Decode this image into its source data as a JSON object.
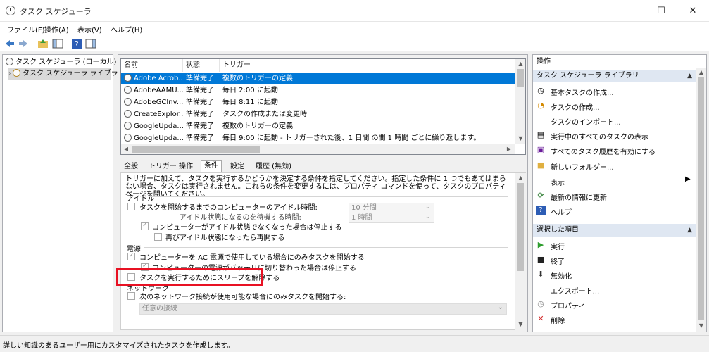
{
  "window": {
    "title": "タスク スケジューラ",
    "controls": {
      "minimize": "—",
      "maximize": "☐",
      "close": "✕"
    }
  },
  "menu": [
    "ファイル(F)",
    "操作(A)",
    "表示(V)",
    "ヘルプ(H)"
  ],
  "tree": {
    "root": "タスク スケジューラ (ローカル)",
    "child": "タスク スケジューラ ライブラリ"
  },
  "task_table": {
    "columns": [
      "名前",
      "状態",
      "トリガー"
    ],
    "rows": [
      {
        "name": "Adobe Acrob...",
        "status": "準備完了",
        "trigger": "複数のトリガーの定義"
      },
      {
        "name": "AdobeAAMU...",
        "status": "準備完了",
        "trigger": "毎日 2:00 に起動"
      },
      {
        "name": "AdobeGCInv...",
        "status": "準備完了",
        "trigger": "毎日 8:11 に起動"
      },
      {
        "name": "CreateExplor...",
        "status": "準備完了",
        "trigger": "タスクの作成または変更時"
      },
      {
        "name": "GoogleUpda...",
        "status": "準備完了",
        "trigger": "複数のトリガーの定義"
      },
      {
        "name": "GoogleUpda...",
        "status": "準備完了",
        "trigger": "毎日 9:00 に起動 - トリガーされた後、1 日間 の間 1 時間 ごとに繰り返します。"
      }
    ]
  },
  "tabs": [
    "全般",
    "トリガー",
    "操作",
    "条件",
    "設定",
    "履歴 (無効)"
  ],
  "conditions": {
    "intro": "トリガーに加えて、タスクを実行するかどうかを決定する条件を指定してください。指定した条件に 1 つでもあてはまらない場合、タスクは実行されません。これらの条件を変更するには、プロパティ コマンドを使って、タスクのプロパティ ページを開いてください。",
    "idle_group": "アイドル",
    "idle_start": "タスクを開始するまでのコンピューターのアイドル時間:",
    "idle_start_value": "10 分間",
    "idle_wait": "アイドル状態になるのを待機する時間:",
    "idle_wait_value": "1 時間",
    "idle_stop": "コンピューターがアイドル状態でなくなった場合は停止する",
    "idle_restart": "再びアイドル状態になったら再開する",
    "power_group": "電源",
    "power_ac_only": "コンピューターを AC 電源で使用している場合にのみタスクを開始する",
    "power_battery_stop": "コンピューターの電源がバッテリに切り替わった場合は停止する",
    "wake_to_run": "タスクを実行するためにスリープを解除する",
    "network_group": "ネットワーク",
    "network_only": "次のネットワーク接続が使用可能な場合にのみタスクを開始する:",
    "network_value": "任意の接続"
  },
  "actions": {
    "header": "操作",
    "library_section": "タスク スケジューラ ライブラリ",
    "library_items": [
      "基本タスクの作成...",
      "タスクの作成...",
      "タスクのインポート...",
      "実行中のすべてのタスクの表示",
      "すべてのタスク履歴を有効にする",
      "新しいフォルダー...",
      "表示",
      "最新の情報に更新",
      "ヘルプ"
    ],
    "selected_section": "選択した項目",
    "selected_items": [
      "実行",
      "終了",
      "無効化",
      "エクスポート...",
      "プロパティ",
      "削除"
    ]
  },
  "status_bar": "詳しい知識のあるユーザー用にカスタマイズされたタスクを作成します。",
  "colors": {
    "selection": "#0078d7",
    "highlight_box": "#e81123",
    "section_bg": "#dfe7f2"
  }
}
